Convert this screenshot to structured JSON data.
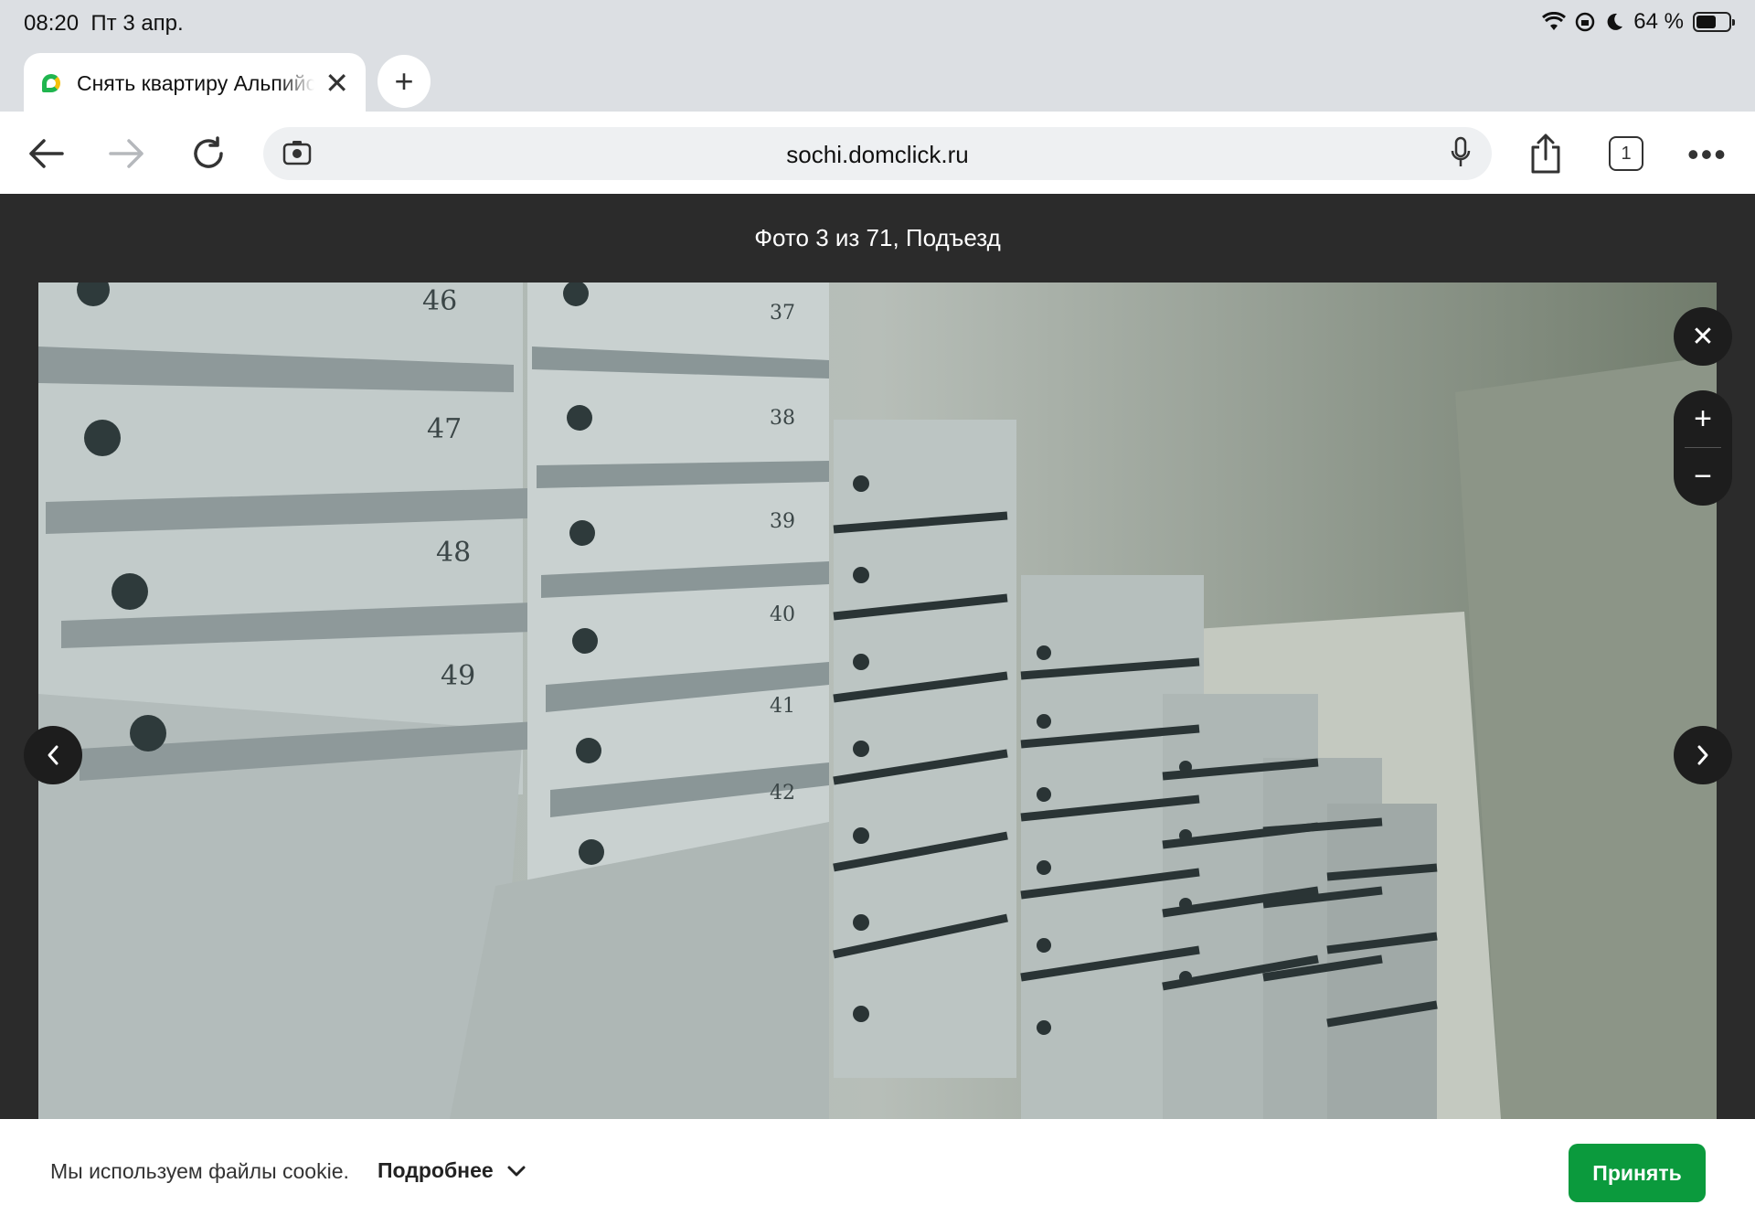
{
  "status_bar": {
    "time": "08:20",
    "date": "Пт 3 апр.",
    "battery": "64 %",
    "battery_level": 0.64
  },
  "tab": {
    "title": "Снять квартиру Альпийская",
    "favicon": "domclick-icon"
  },
  "toolbar": {
    "url": "sochi.domclick.ru",
    "tab_count": "1"
  },
  "viewer": {
    "caption": "Фото 3 из 71, Подъезд",
    "box_numbers_left": [
      "46",
      "47",
      "48",
      "49"
    ],
    "box_numbers_mid": [
      "37",
      "38",
      "39",
      "40",
      "41",
      "42"
    ]
  },
  "cookie": {
    "message": "Мы используем файлы cookie.",
    "more_label": "Подробнее",
    "accept_label": "Принять"
  },
  "colors": {
    "accent": "#0b9a3d",
    "header": "#2b2b2b",
    "chrome": "#dcdfe3"
  }
}
